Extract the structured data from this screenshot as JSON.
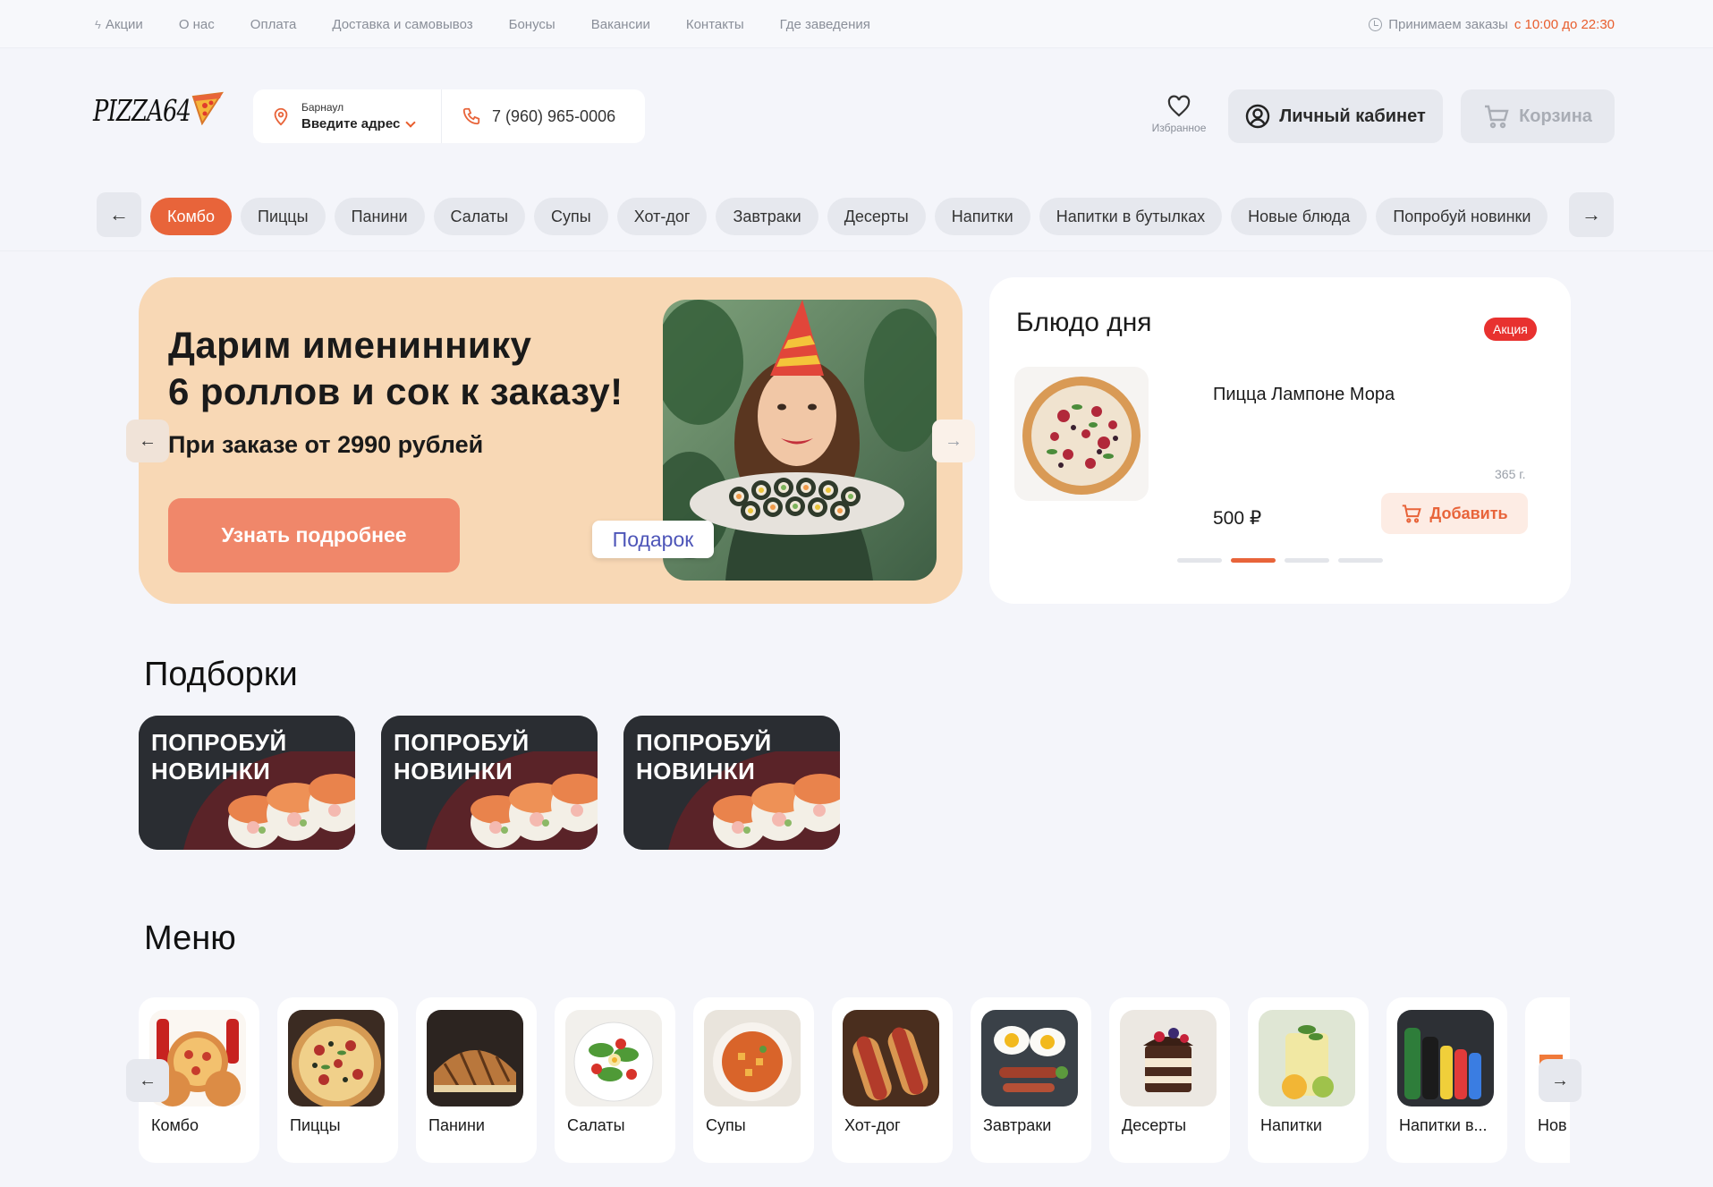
{
  "topnav": {
    "items": [
      "Акции",
      "О нас",
      "Оплата",
      "Доставка и самовывоз",
      "Бонусы",
      "Вакансии",
      "Контакты",
      "Где заведения"
    ],
    "hours_prefix": "Принимаем заказы",
    "hours_value": "с 10:00 до 22:30"
  },
  "header": {
    "logo_text": "PIZZA64",
    "city": "Барнаул",
    "address_placeholder": "Введите адрес",
    "phone": "7 (960) 965-0006",
    "favorites_label": "Избранное",
    "cabinet_label": "Личный кабинет",
    "cart_label": "Корзина"
  },
  "categories": {
    "items": [
      "Комбо",
      "Пиццы",
      "Панини",
      "Салаты",
      "Супы",
      "Хот-дог",
      "Завтраки",
      "Десерты",
      "Напитки",
      "Напитки в бутылках",
      "Новые блюда",
      "Попробуй новинки"
    ],
    "active_index": 0
  },
  "hero": {
    "title_line1": "Дарим имениннику",
    "title_line2": "6 роллов и сок к заказу!",
    "subtitle": "При заказе от 2990 рублей",
    "button_label": "Узнать подробнее",
    "tag_label": "Подарок"
  },
  "dish_of_day": {
    "title": "Блюдо дня",
    "badge": "Акция",
    "name": "Пицца Лампоне Мора",
    "weight": "365 г.",
    "price": "500 ₽",
    "add_label": "Добавить",
    "slides_count": 4,
    "active_slide": 1
  },
  "collections": {
    "title": "Подборки",
    "cards": [
      {
        "line1": "ПОПРОБУЙ",
        "line2": "НОВИНКИ"
      },
      {
        "line1": "ПОПРОБУЙ",
        "line2": "НОВИНКИ"
      },
      {
        "line1": "ПОПРОБУЙ",
        "line2": "НОВИНКИ"
      }
    ]
  },
  "menu": {
    "title": "Меню",
    "items": [
      "Комбо",
      "Пиццы",
      "Панини",
      "Салаты",
      "Супы",
      "Хот-дог",
      "Завтраки",
      "Десерты",
      "Напитки",
      "Напитки в...",
      "Нов"
    ]
  },
  "colors": {
    "accent": "#e8643a",
    "badge_red": "#e8312f",
    "hero_bg": "#f8d8b5",
    "page_bg": "#f4f5fa"
  }
}
